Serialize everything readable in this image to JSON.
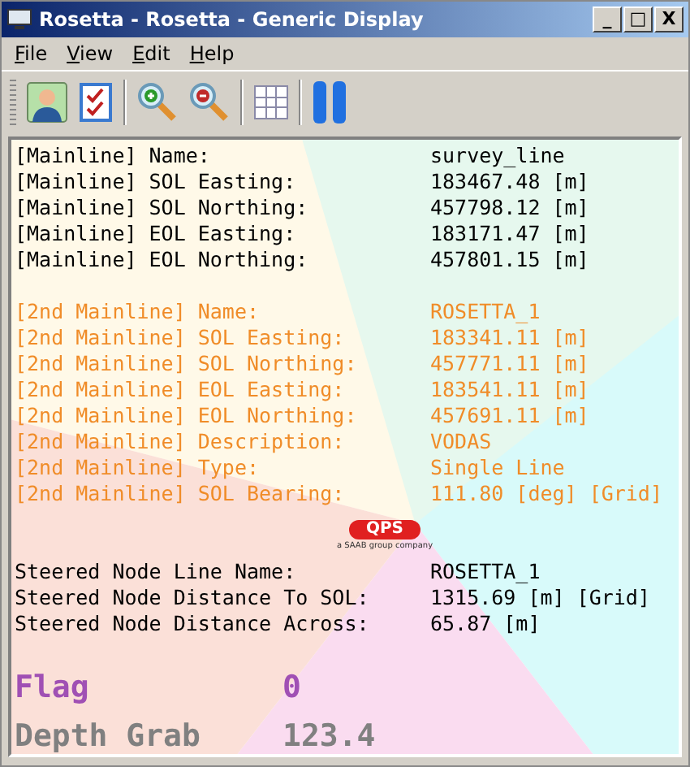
{
  "window": {
    "title": "Rosetta - Rosetta  - Generic Display",
    "controls": [
      "_",
      "□",
      "X"
    ]
  },
  "menu": [
    {
      "label": "File"
    },
    {
      "label": "View"
    },
    {
      "label": "Edit"
    },
    {
      "label": "Help"
    }
  ],
  "toolbar": [
    {
      "kind": "person"
    },
    {
      "kind": "checklist"
    },
    {
      "kind": "sep"
    },
    {
      "kind": "zoom-in"
    },
    {
      "kind": "zoom-out"
    },
    {
      "kind": "sep"
    },
    {
      "kind": "grid"
    },
    {
      "kind": "sep"
    },
    {
      "kind": "pause"
    }
  ],
  "sections": [
    {
      "color": "#000000",
      "rows": [
        {
          "label": "[Mainline] Name:",
          "value": "survey_line"
        },
        {
          "label": "[Mainline] SOL Easting:",
          "value": "183467.48 [m]"
        },
        {
          "label": "[Mainline] SOL Northing:",
          "value": "457798.12 [m]"
        },
        {
          "label": "[Mainline] EOL Easting:",
          "value": "183171.47 [m]"
        },
        {
          "label": "[Mainline] EOL Northing:",
          "value": "457801.15 [m]"
        }
      ]
    },
    {
      "color": "#f08c28",
      "rows": [
        {
          "label": "[2nd Mainline] Name:",
          "value": "ROSETTA_1"
        },
        {
          "label": "[2nd Mainline] SOL Easting:",
          "value": "183341.11 [m]"
        },
        {
          "label": "[2nd Mainline] SOL Northing:",
          "value": "457771.11 [m]"
        },
        {
          "label": "[2nd Mainline] EOL Easting:",
          "value": "183541.11 [m]"
        },
        {
          "label": "[2nd Mainline] EOL Northing:",
          "value": "457691.11 [m]"
        },
        {
          "label": "[2nd Mainline] Description:",
          "value": "VODAS"
        },
        {
          "label": "[2nd Mainline] Type:",
          "value": "Single Line"
        },
        {
          "label": "[2nd Mainline] SOL Bearing:",
          "value": "111.80 [deg] [Grid]"
        }
      ]
    },
    {
      "color": "#000000",
      "rows": [
        {
          "label": "Steered Node Line Name:",
          "value": "ROSETTA_1"
        },
        {
          "label": "Steered Node Distance To SOL:",
          "value": "1315.69 [m] [Grid]"
        },
        {
          "label": "Steered Node Distance Across:",
          "value": "65.87 [m]"
        }
      ]
    }
  ],
  "logo": {
    "name": "QPS",
    "tagline": "a SAAB group company"
  },
  "big": [
    {
      "label": "Flag",
      "value": "0",
      "color": "#a050b4"
    },
    {
      "label": "Depth Grab",
      "value": "123.4",
      "color": "#808080"
    }
  ]
}
